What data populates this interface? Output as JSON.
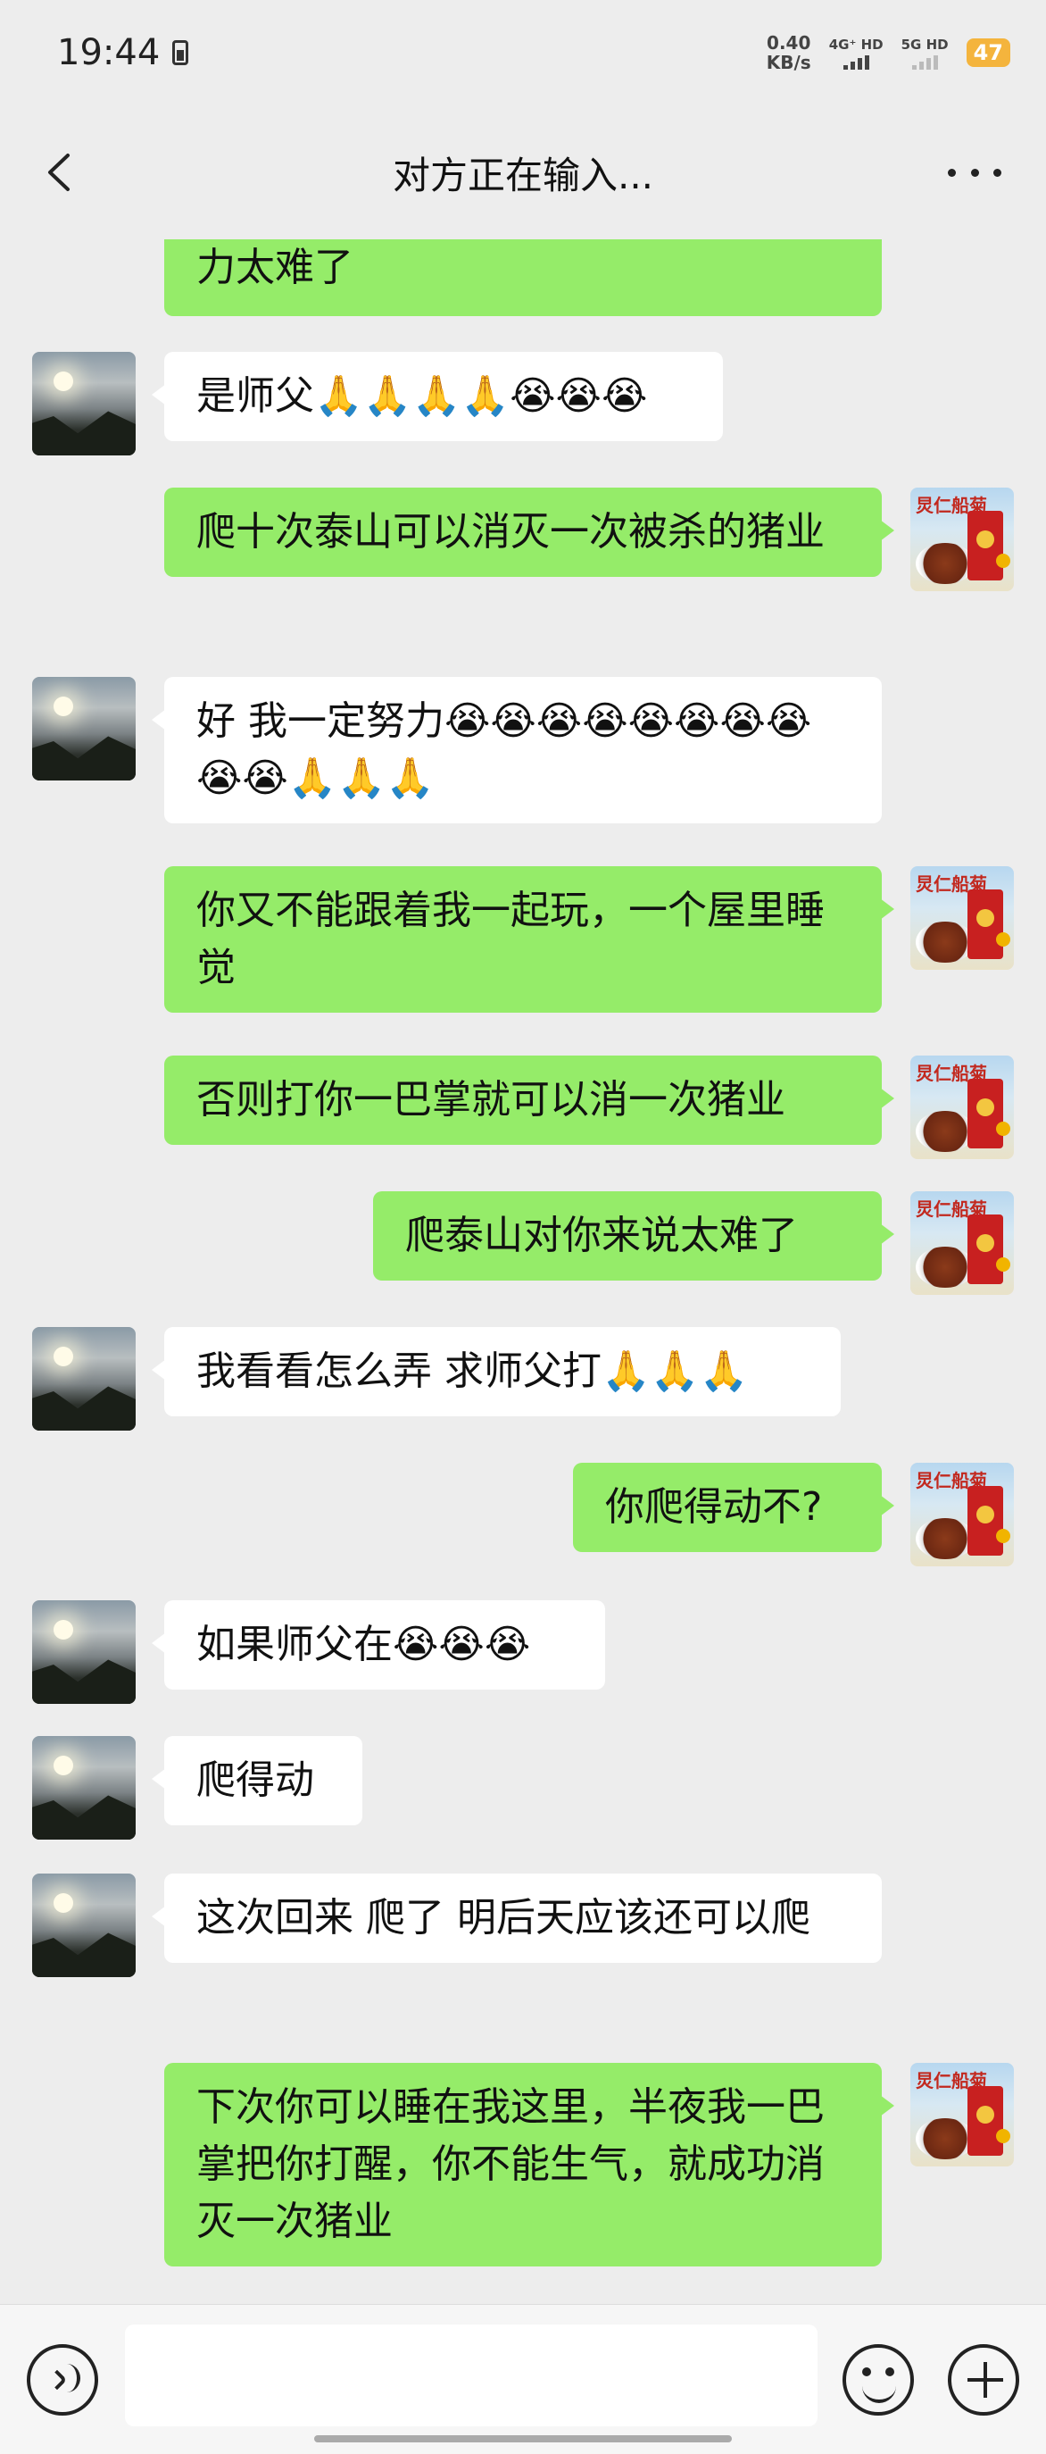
{
  "status_bar": {
    "time": "19:44",
    "net_speed_value": "0.40",
    "net_speed_unit": "KB/s",
    "signal_1_label": "4G⁺ HD",
    "signal_2_label": "5G HD",
    "battery": "47"
  },
  "header": {
    "title": "对方正在输入..."
  },
  "avatars": {
    "self_avatar_text": "炅仁船菊"
  },
  "messages": [
    {
      "side": "out",
      "text": "力太难了"
    },
    {
      "side": "in",
      "text": "是师父🙏🙏🙏🙏😭😭😭"
    },
    {
      "side": "out",
      "text": "爬十次泰山可以消灭一次被杀的猪业"
    },
    {
      "side": "in",
      "text": "好 我一定努力😭😭😭😭😭😭😭😭😭😭🙏🙏🙏"
    },
    {
      "side": "out",
      "text": "你又不能跟着我一起玩，一个屋里睡觉"
    },
    {
      "side": "out",
      "text": "否则打你一巴掌就可以消一次猪业"
    },
    {
      "side": "out",
      "text": "爬泰山对你来说太难了"
    },
    {
      "side": "in",
      "text": "我看看怎么弄 求师父打🙏🙏🙏"
    },
    {
      "side": "out",
      "text": "你爬得动不?"
    },
    {
      "side": "in",
      "text": "如果师父在😭😭😭"
    },
    {
      "side": "in",
      "text": "爬得动"
    },
    {
      "side": "in",
      "text": "这次回来 爬了 明后天应该还可以爬"
    },
    {
      "side": "out",
      "text": "下次你可以睡在我这里，半夜我一巴掌把你打醒，你不能生气，就成功消灭一次猪业"
    }
  ],
  "input_bar": {
    "placeholder": ""
  },
  "colors": {
    "background": "#ededed",
    "outgoing_bubble": "#95ec69",
    "incoming_bubble": "#ffffff",
    "battery": "#f4b43d"
  },
  "icons": [
    "back-icon",
    "more-icon",
    "voice-icon",
    "emoji-icon",
    "plus-icon",
    "sim-icon",
    "signal-icon",
    "battery-icon"
  ]
}
